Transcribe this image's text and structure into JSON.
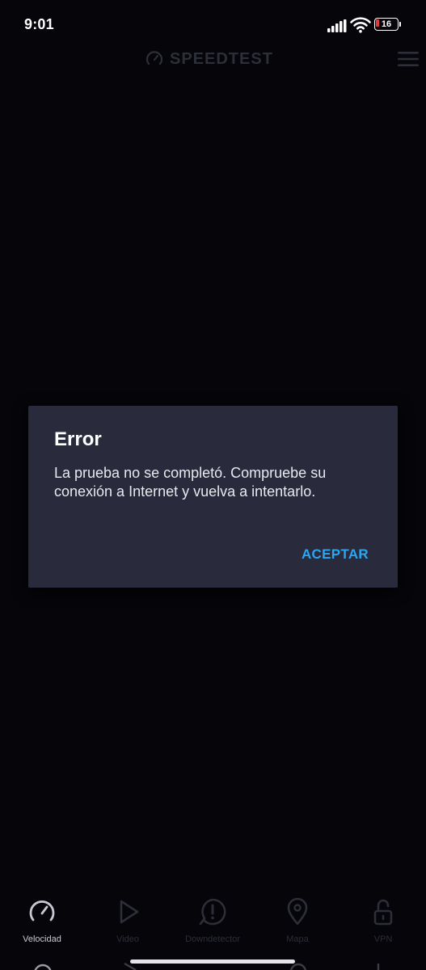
{
  "status_bar": {
    "time": "9:01",
    "battery_level": "16"
  },
  "header": {
    "logo_text": "SPEEDTEST",
    "icons": [
      "speedometer-icon",
      "hamburger-menu-icon"
    ]
  },
  "dialog": {
    "title": "Error",
    "message": "La prueba no se completó. Compruebe su conexión a Internet y vuelva a intentarlo.",
    "button_label": "ACEPTAR"
  },
  "bottom_nav": {
    "items": [
      {
        "label": "Velocidad",
        "icon": "speedometer-icon",
        "active": true
      },
      {
        "label": "Video",
        "icon": "play-icon",
        "active": false
      },
      {
        "label": "Downdetector",
        "icon": "alert-bubble-icon",
        "active": false
      },
      {
        "label": "Mapa",
        "icon": "map-pin-icon",
        "active": false
      },
      {
        "label": "VPN",
        "icon": "unlock-icon",
        "active": false
      }
    ]
  },
  "colors": {
    "background": "#05050a",
    "dialog_background": "#292b3d",
    "accent": "#2ba6f2",
    "inactive": "#2c2e38",
    "battery_low": "#e03a3a"
  }
}
